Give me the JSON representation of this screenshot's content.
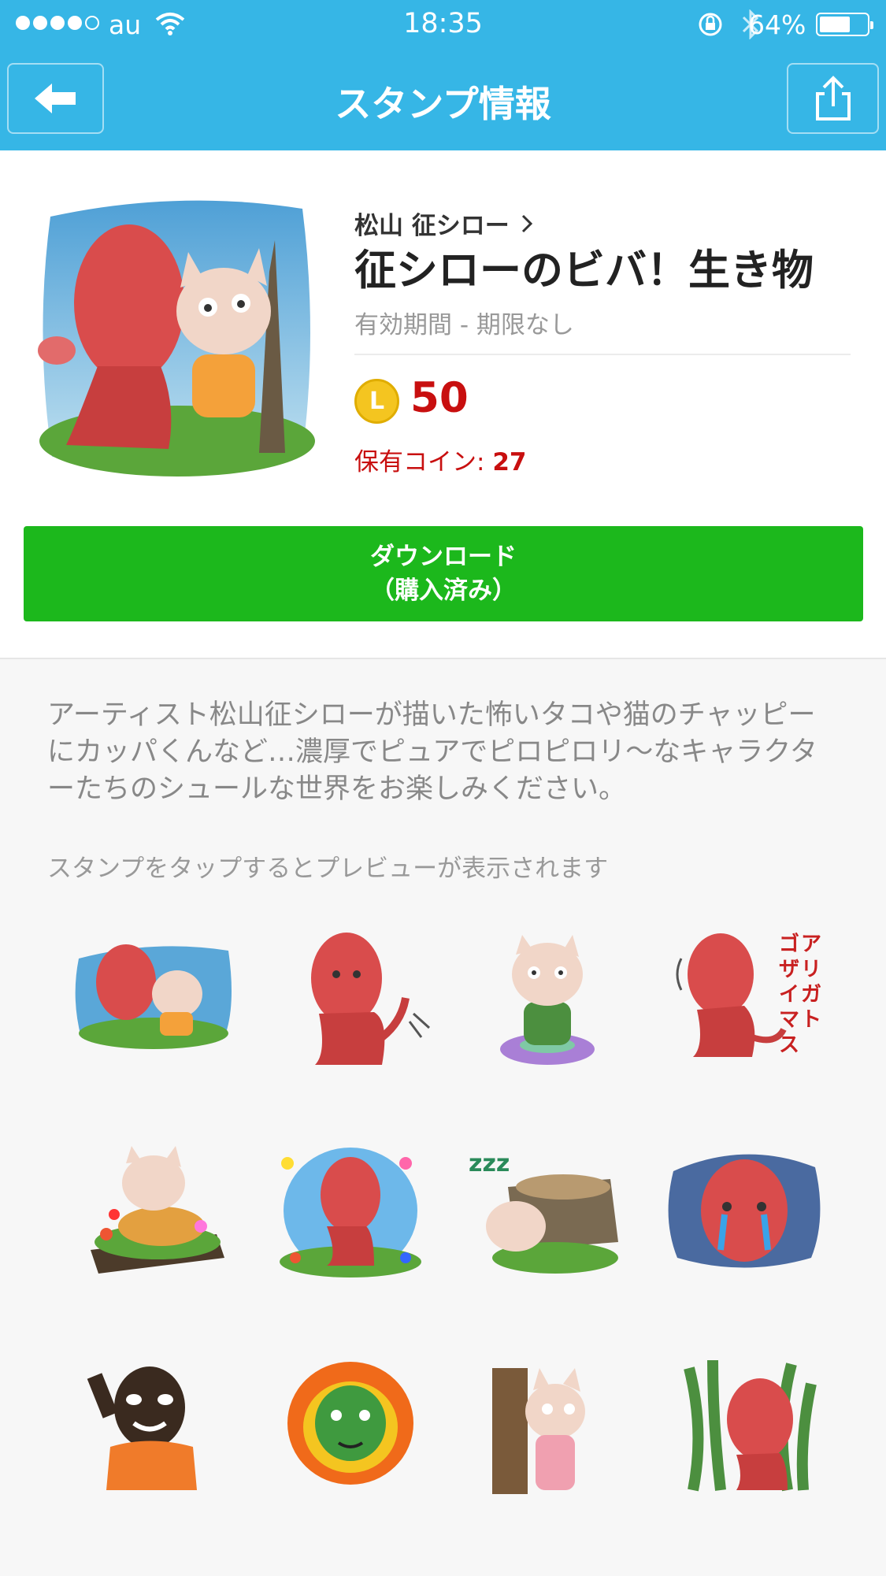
{
  "status_bar": {
    "carrier": "au",
    "time": "18:35",
    "battery_percent": "64%",
    "battery_level": 0.64
  },
  "nav": {
    "title": "スタンプ情報",
    "back_icon": "back-arrow-icon",
    "share_icon": "share-icon"
  },
  "product": {
    "author": "松山 征シロー",
    "title": "征シローのビバ！生き物",
    "validity": "有効期間 - 期限なし",
    "coin_symbol": "L",
    "price": "50",
    "owned_label": "保有コイン: ",
    "owned_value": "27",
    "download_line1": "ダウンロード",
    "download_line2": "（購入済み）"
  },
  "detail": {
    "description": "アーティスト松山征シローが描いた怖いタコや猫のチャッピーにカッパくんなど…濃厚でピュアでピロピロリ〜なキャラクターたちのシュールな世界をお楽しみください。",
    "preview_hint": "スタンプをタップするとプレビューが表示されます"
  },
  "stickers": [
    {
      "kind": "octopus-cat"
    },
    {
      "kind": "octopus-wave"
    },
    {
      "kind": "cat-cushion"
    },
    {
      "kind": "octopus-thanks",
      "caption": "アリガトゴザイマス"
    },
    {
      "kind": "cat-flowers"
    },
    {
      "kind": "octopus-flowers"
    },
    {
      "kind": "cat-sleep",
      "caption": "zzz"
    },
    {
      "kind": "octopus-cry"
    },
    {
      "kind": "man-wave"
    },
    {
      "kind": "kappa-fire"
    },
    {
      "kind": "cat-tree"
    },
    {
      "kind": "octopus-plants"
    }
  ],
  "colors": {
    "brand": "#36b6e6",
    "download": "#1cb81c",
    "price": "#c80f0f"
  }
}
